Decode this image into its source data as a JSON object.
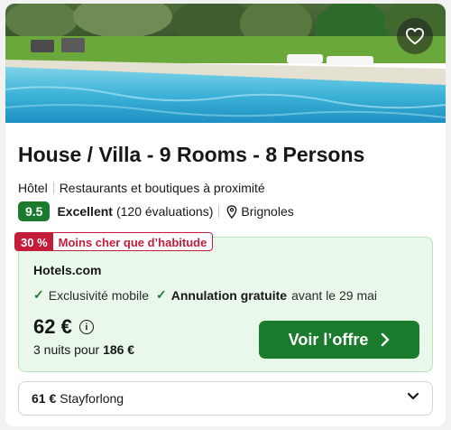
{
  "listing": {
    "title": "House / Villa - 9 Rooms - 8 Persons",
    "type": "Hôtel",
    "nearby": "Restaurants et boutiques à proximité",
    "score": "9.5",
    "rating_label": "Excellent",
    "reviews": "(120 évaluations)",
    "location": "Brignoles"
  },
  "deal": {
    "discount": "30 %",
    "discount_text": "Moins cher que d’habitude",
    "provider": "Hotels.com",
    "feature1": "Exclusivité mobile",
    "feature2": "Annulation gratuite",
    "feature2_suffix": "avant le 29 mai",
    "price": "62 €",
    "nights_prefix": "3 nuits pour",
    "nights_total": "186 €",
    "cta": "Voir l’offre"
  },
  "alternative": {
    "price": "61 €",
    "provider": "Stayforlong"
  },
  "icons": {
    "favorite": "heart-icon",
    "location": "map-pin-icon",
    "info": "info-icon",
    "check": "check-icon",
    "cta_arrow": "chevron-right-icon",
    "dropdown": "chevron-down-icon"
  },
  "colors": {
    "brand_green": "#1b7b2c",
    "deal_red": "#c31d3a",
    "deal_background": "#eaf8ec"
  }
}
